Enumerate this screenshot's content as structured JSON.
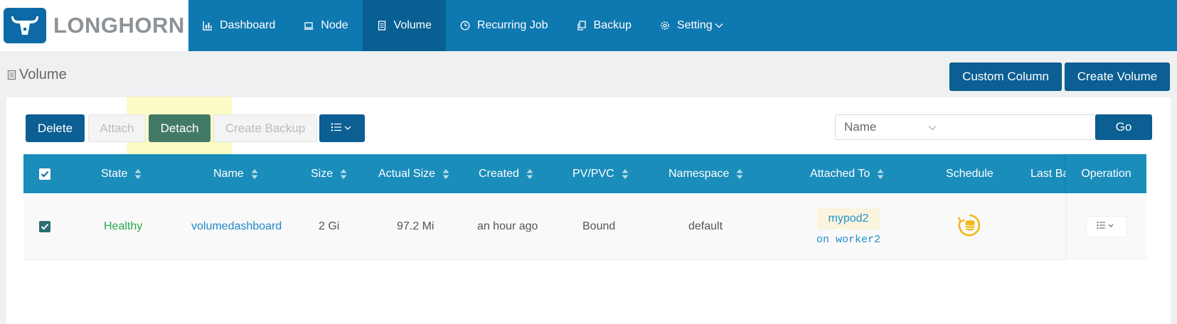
{
  "brand": {
    "name": "LONGHORN",
    "logo_icon": "longhorn-logo-icon"
  },
  "nav": {
    "items": [
      {
        "label": "Dashboard",
        "icon": "bar-chart-icon"
      },
      {
        "label": "Node",
        "icon": "laptop-icon"
      },
      {
        "label": "Volume",
        "icon": "volume-icon",
        "active": true
      },
      {
        "label": "Recurring Job",
        "icon": "clock-icon"
      },
      {
        "label": "Backup",
        "icon": "copy-icon"
      },
      {
        "label": "Setting",
        "icon": "gear-icon"
      }
    ]
  },
  "header": {
    "title": "Volume",
    "custom_column_label": "Custom Column",
    "create_volume_label": "Create Volume"
  },
  "toolbar": {
    "delete_label": "Delete",
    "attach_label": "Attach",
    "detach_label": "Detach",
    "create_backup_label": "Create Backup",
    "more_icon": "list-icon"
  },
  "filter": {
    "field_value": "Name",
    "input_value": "",
    "go_label": "Go"
  },
  "table": {
    "columns": {
      "state": "State",
      "name": "Name",
      "size": "Size",
      "actual_size": "Actual Size",
      "created": "Created",
      "pvpvc": "PV/PVC",
      "namespace": "Namespace",
      "attached_to": "Attached To",
      "schedule": "Schedule",
      "last_backup": "Last Backup",
      "operation": "Operation"
    },
    "rows": [
      {
        "selected": true,
        "state": "Healthy",
        "name": "volumedashboard",
        "size": "2 Gi",
        "actual_size": "97.2 Mi",
        "created": "an hour ago",
        "pvpvc": "Bound",
        "namespace": "default",
        "attached_pod": "mypod2",
        "attached_node": "on worker2",
        "schedule_icon": "schedule-backup-icon"
      }
    ]
  },
  "colors": {
    "nav_bg": "#0e78b0",
    "nav_active": "#075f92",
    "primary_button": "#0b5f93",
    "detach_button": "#427a67",
    "table_header": "#1a8dbb",
    "healthy": "#29a84e",
    "link": "#1f88c9",
    "schedule_icon": "#f0b81c"
  }
}
